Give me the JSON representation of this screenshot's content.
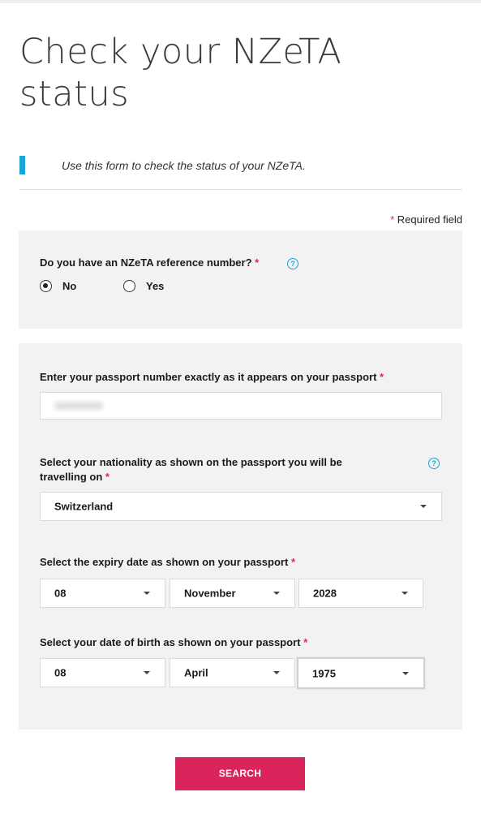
{
  "page": {
    "title": "Check your NZeTA status",
    "intro": "Use this form to check the status of your NZeTA."
  },
  "required_note": {
    "star": "*",
    "text": "Required field"
  },
  "reference_question": {
    "label": "Do you have an NZeTA reference number?",
    "options": [
      {
        "label": "No",
        "selected": true
      },
      {
        "label": "Yes",
        "selected": false
      }
    ]
  },
  "passport_number": {
    "label": "Enter your passport number exactly as it appears on your passport",
    "value": "S0000000"
  },
  "nationality": {
    "label_line1": "Select your nationality as shown on the passport you will be",
    "label_line2": "travelling on",
    "value": "Switzerland"
  },
  "expiry_date": {
    "label": "Select the expiry date as shown on your passport",
    "day": "08",
    "month": "November",
    "year": "2028"
  },
  "date_of_birth": {
    "label": "Select your date of birth as shown on your passport",
    "day": "08",
    "month": "April",
    "year": "1975"
  },
  "help_icon_glyph": "?",
  "search_button": {
    "label": "SEARCH"
  },
  "colors": {
    "accent": "#1aa5d8",
    "button": "#d9245c",
    "required": "#e3245a",
    "panel": "#f2f2f2"
  }
}
